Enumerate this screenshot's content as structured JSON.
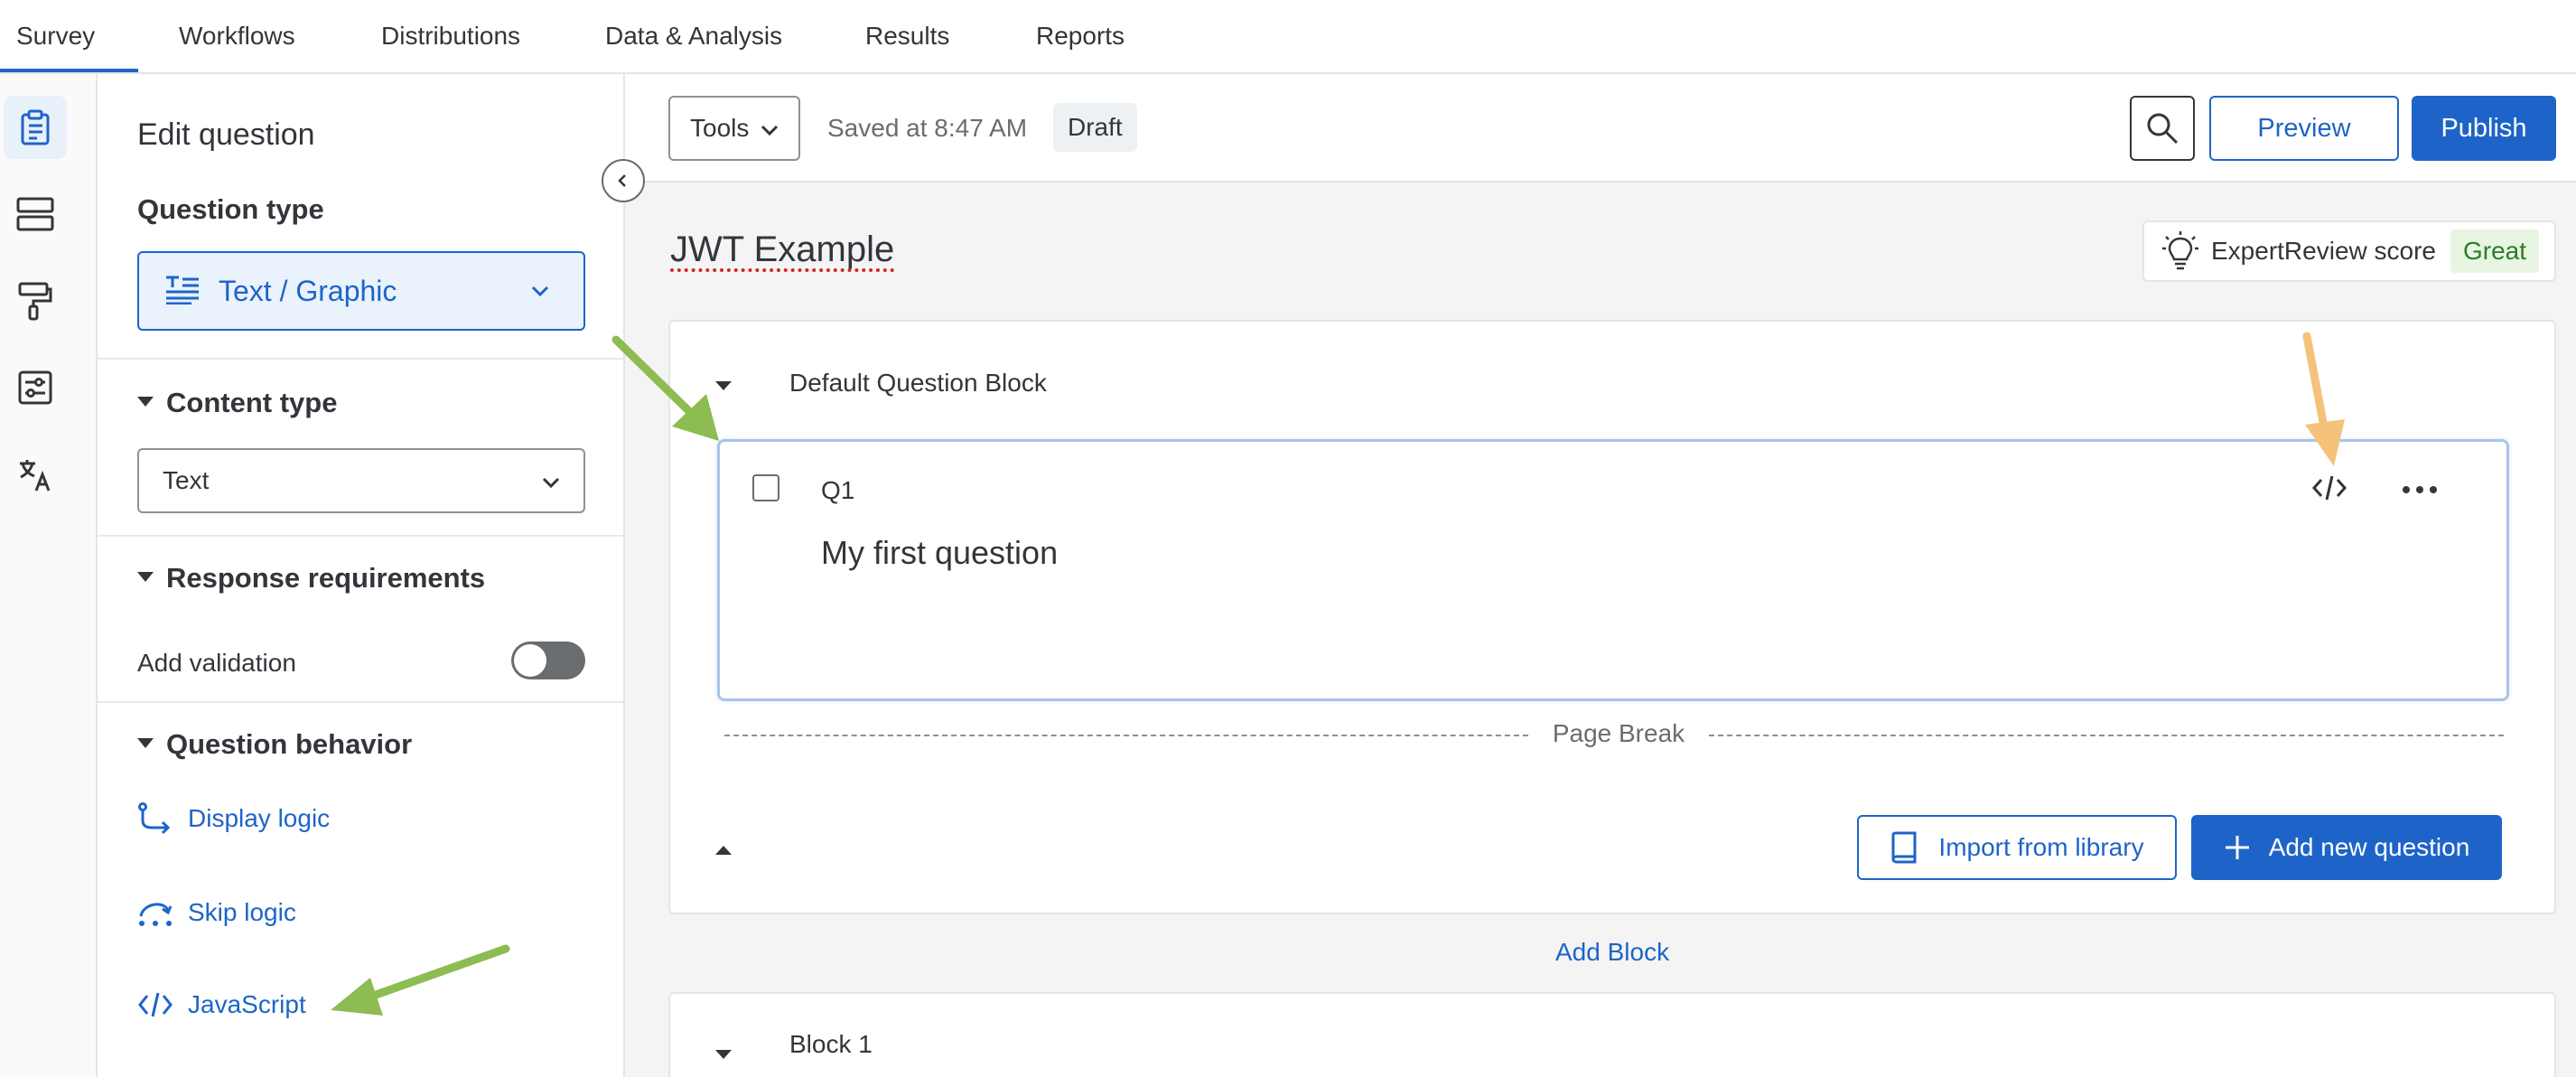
{
  "nav": {
    "tabs": [
      {
        "label": "Survey",
        "active": true
      },
      {
        "label": "Workflows"
      },
      {
        "label": "Distributions"
      },
      {
        "label": "Data & Analysis"
      },
      {
        "label": "Results"
      },
      {
        "label": "Reports"
      }
    ]
  },
  "rail": {
    "icons": [
      "clipboard-icon",
      "layout-icon",
      "paint-roller-icon",
      "sliders-icon",
      "translate-icon"
    ]
  },
  "panel": {
    "title": "Edit question",
    "question_type_label": "Question type",
    "question_type_value": "Text / Graphic",
    "content_type_label": "Content type",
    "content_type_value": "Text",
    "response_requirements_label": "Response requirements",
    "add_validation_label": "Add validation",
    "add_validation_on": false,
    "question_behavior_label": "Question behavior",
    "links": [
      "Display logic",
      "Skip logic",
      "JavaScript"
    ]
  },
  "toolbar": {
    "tools_label": "Tools",
    "saved_text": "Saved at 8:47 AM",
    "status_badge": "Draft",
    "preview_label": "Preview",
    "publish_label": "Publish"
  },
  "survey": {
    "title": "JWT Example",
    "expert_review_label": "ExpertReview score",
    "expert_review_value": "Great",
    "blocks": [
      {
        "title": "Default Question Block",
        "question": {
          "id": "Q1",
          "text": "My first question"
        },
        "page_break": "Page Break",
        "import_label": "Import from library",
        "add_label": "Add new question"
      },
      {
        "title": "Block 1"
      }
    ],
    "add_block_label": "Add Block"
  },
  "colors": {
    "accent": "#1e64c8",
    "annotation_green": "#8cbc52",
    "annotation_orange": "#f5c27a"
  }
}
